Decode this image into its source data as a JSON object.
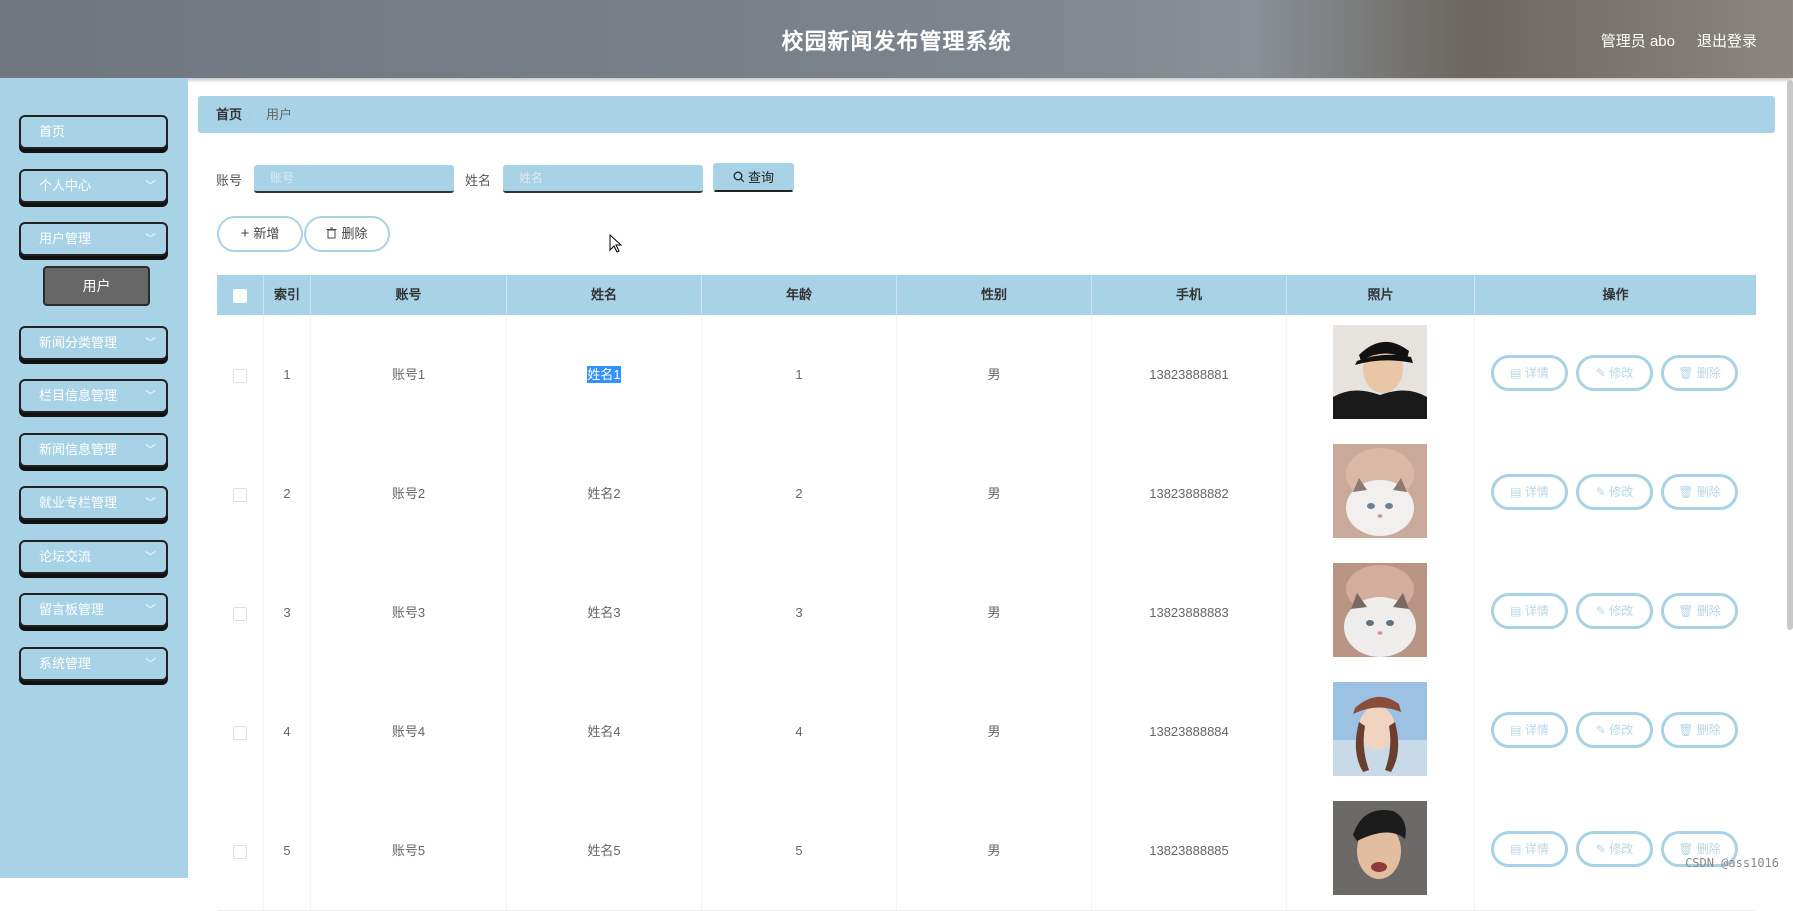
{
  "header": {
    "title": "校园新闻发布管理系统",
    "user": "管理员 abo",
    "logout": "退出登录"
  },
  "sidebar": {
    "items": [
      {
        "label": "首页"
      },
      {
        "label": "个人中心"
      },
      {
        "label": "用户管理"
      },
      {
        "label": "新闻分类管理"
      },
      {
        "label": "栏目信息管理"
      },
      {
        "label": "新闻信息管理"
      },
      {
        "label": "就业专栏管理"
      },
      {
        "label": "论坛交流"
      },
      {
        "label": "留言板管理"
      },
      {
        "label": "系统管理"
      }
    ],
    "submenu": {
      "label": "用户"
    }
  },
  "breadcrumb": {
    "home": "首页",
    "separator": "/",
    "current": "用户"
  },
  "search": {
    "account_label": "账号",
    "account_placeholder": "账号",
    "name_label": "姓名",
    "name_placeholder": "姓名",
    "query_label": "查询"
  },
  "toolbar": {
    "add_label": "新增",
    "delete_label": "删除"
  },
  "table": {
    "columns": [
      "索引",
      "账号",
      "姓名",
      "年龄",
      "性别",
      "手机",
      "照片",
      "操作"
    ],
    "rows": [
      {
        "index": "1",
        "account": "账号1",
        "name": "姓名1",
        "age": "1",
        "gender": "男",
        "phone": "13823888881"
      },
      {
        "index": "2",
        "account": "账号2",
        "name": "姓名2",
        "age": "2",
        "gender": "男",
        "phone": "13823888882"
      },
      {
        "index": "3",
        "account": "账号3",
        "name": "姓名3",
        "age": "3",
        "gender": "男",
        "phone": "13823888883"
      },
      {
        "index": "4",
        "account": "账号4",
        "name": "姓名4",
        "age": "4",
        "gender": "男",
        "phone": "13823888884"
      },
      {
        "index": "5",
        "account": "账号5",
        "name": "姓名5",
        "age": "5",
        "gender": "男",
        "phone": "13823888885"
      }
    ],
    "actions": {
      "detail": "详情",
      "edit": "修改",
      "delete": "删除"
    }
  },
  "watermark": "CSDN @ass1016",
  "colors": {
    "accent": "#a8d2e6",
    "submenu_active": "#676767",
    "selection": "#3390ff"
  }
}
